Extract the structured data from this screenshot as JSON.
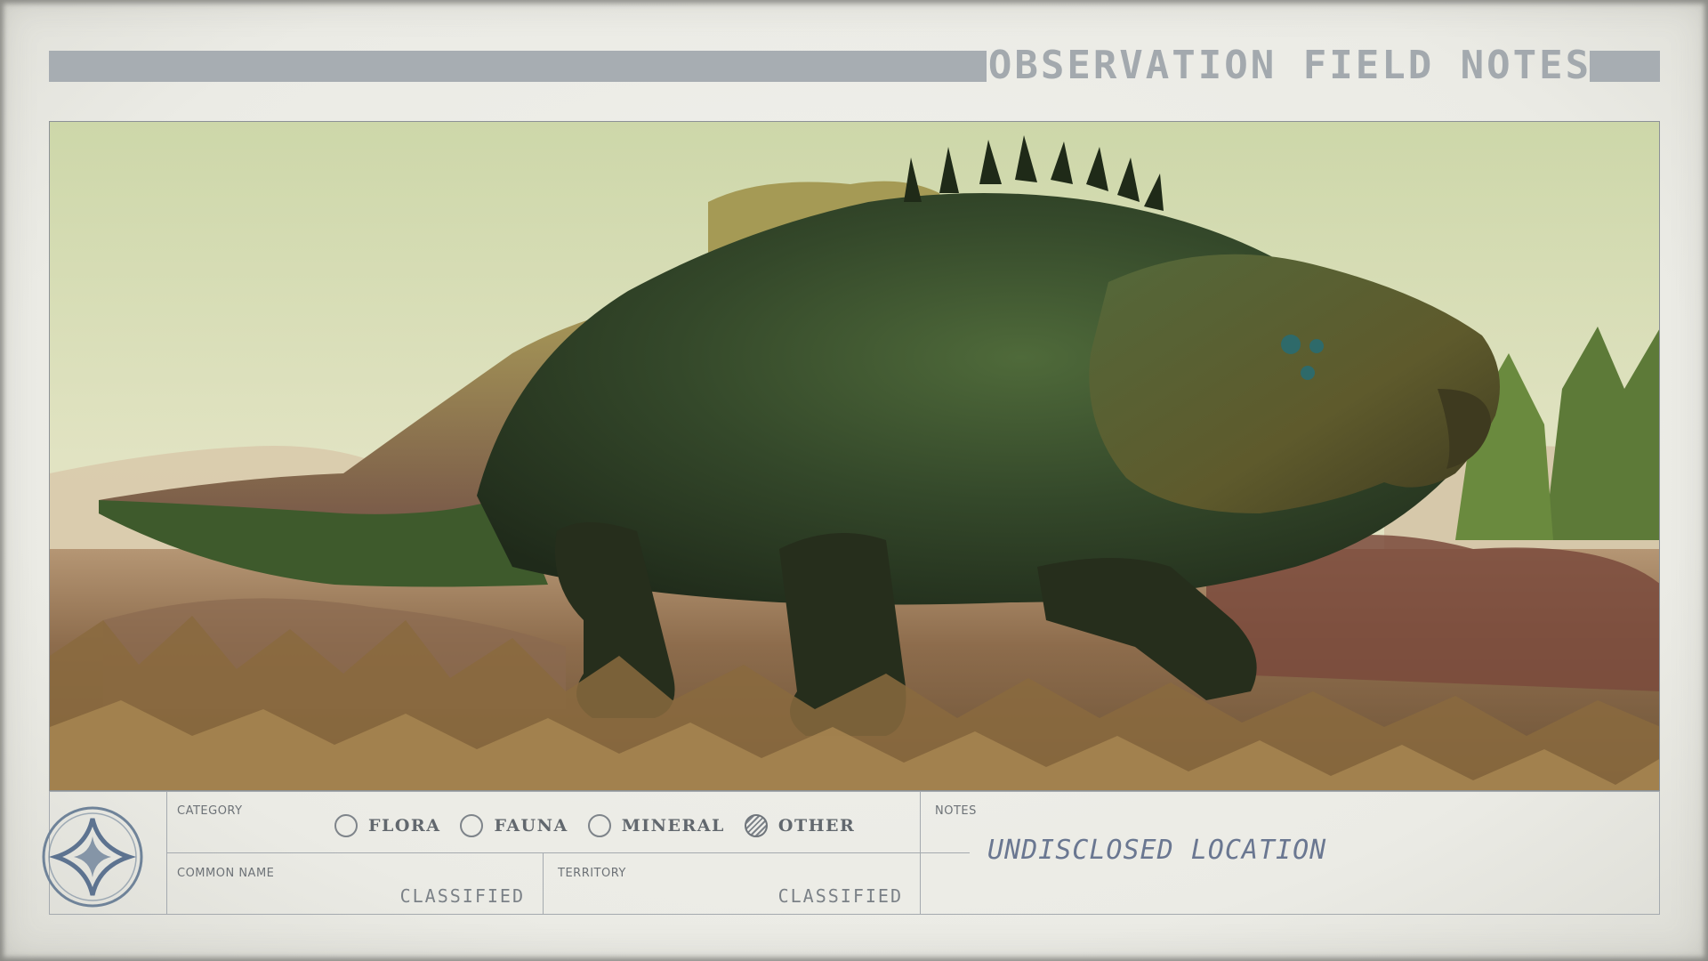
{
  "header": {
    "title": "OBSERVATION FIELD NOTES"
  },
  "photo": {
    "subject": "creature-photo"
  },
  "footer": {
    "category_label": "CATEGORY",
    "categories": [
      {
        "label": "FLORA",
        "selected": false
      },
      {
        "label": "FAUNA",
        "selected": false
      },
      {
        "label": "MINERAL",
        "selected": false
      },
      {
        "label": "OTHER",
        "selected": true
      }
    ],
    "common_name_label": "COMMON NAME",
    "common_name_value": "CLASSIFIED",
    "territory_label": "TERRITORY",
    "territory_value": "CLASSIFIED",
    "notes_label": "NOTES",
    "notes_value": "UNDISCLOSED LOCATION"
  },
  "colors": {
    "paper": "#ebebe5",
    "header_bar": "#a7adb2",
    "ink_gray": "#7b8187",
    "handwriting": "#6a7791"
  }
}
